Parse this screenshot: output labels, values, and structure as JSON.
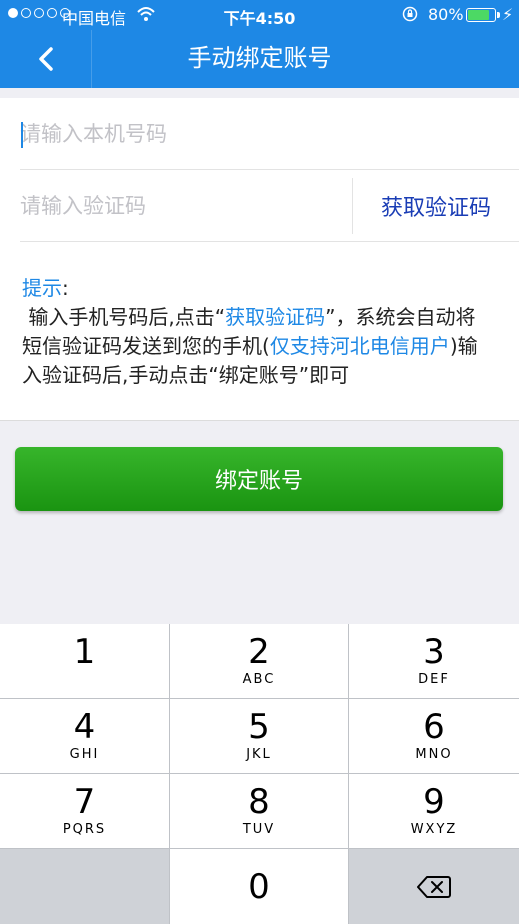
{
  "status": {
    "carrier": "中国电信",
    "time": "下午4:50",
    "battery_pct": "80%",
    "battery_level": 0.8
  },
  "nav": {
    "title": "手动绑定账号",
    "back_icon": "chevron-left-icon"
  },
  "form": {
    "phone_placeholder": "请输入本机号码",
    "code_placeholder": "请输入验证码",
    "get_code_label": "获取验证码"
  },
  "tips": {
    "heading": "提示",
    "colon": ":",
    "line_1a": "输入手机号码后,点击“",
    "line_1b": "获取验证码",
    "line_1c": "”，系统会自动将短信验证码发送到您的手机(",
    "line_1d": "仅支持河北电信用户",
    "line_1e": ")输入验证码后,手动点击“绑定账号”即可"
  },
  "bind_button_label": "绑定账号",
  "keypad": {
    "keys": [
      {
        "num": "1",
        "letters": ""
      },
      {
        "num": "2",
        "letters": "ABC"
      },
      {
        "num": "3",
        "letters": "DEF"
      },
      {
        "num": "4",
        "letters": "GHI"
      },
      {
        "num": "5",
        "letters": "JKL"
      },
      {
        "num": "6",
        "letters": "MNO"
      },
      {
        "num": "7",
        "letters": "PQRS"
      },
      {
        "num": "8",
        "letters": "TUV"
      },
      {
        "num": "9",
        "letters": "WXYZ"
      },
      {
        "num": "0",
        "letters": ""
      }
    ],
    "delete_icon": "backspace-icon"
  },
  "colors": {
    "nav_blue": "#1e88e5",
    "link_blue": "#1a3db5",
    "button_green": "#22a017"
  }
}
